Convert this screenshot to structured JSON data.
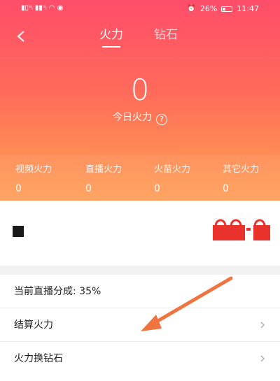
{
  "status_bar": {
    "left": "▮▯ᵘₗ ▮▮ᵘₗ ◠ ◉",
    "right_battery": "26%",
    "time": "11:47"
  },
  "header": {
    "tabs": [
      {
        "label": "火力",
        "active": true
      },
      {
        "label": "钻石",
        "active": false
      }
    ],
    "today_value": "0",
    "today_label": "今日火力",
    "stats": [
      {
        "label": "视频火力",
        "value": "0"
      },
      {
        "label": "直播火力",
        "value": "0"
      },
      {
        "label": "火苗火力",
        "value": "0"
      },
      {
        "label": "其它火力",
        "value": "0"
      }
    ]
  },
  "list": [
    {
      "text": "当前直播分成: 35%",
      "has_chevron": false
    },
    {
      "text": "结算火力",
      "has_chevron": true
    },
    {
      "text": "火力换钻石",
      "has_chevron": true
    }
  ],
  "icons": {
    "back": "chevron-left-icon",
    "help": "question-circle-icon",
    "chevron": "chevron-right-icon"
  },
  "colors": {
    "header_gradient": [
      "#ff4d6a",
      "#ffa05a"
    ],
    "gift_red": "#e8322b",
    "arrow_orange": "#f07440"
  }
}
